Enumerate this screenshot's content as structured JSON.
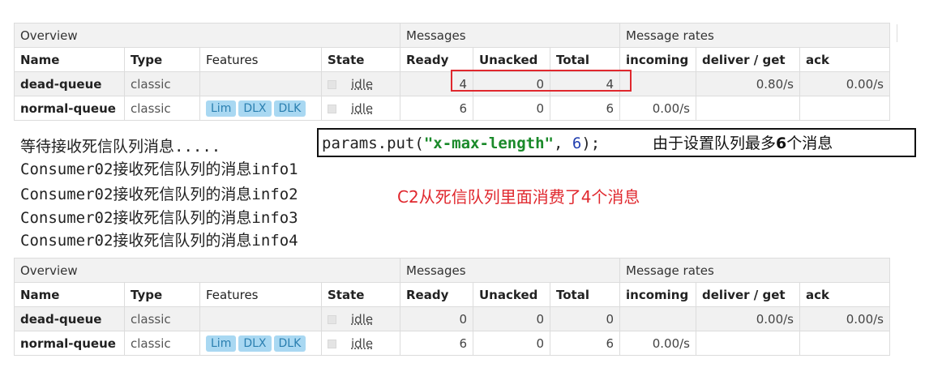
{
  "tables": [
    {
      "groups": {
        "overview": "Overview",
        "messages": "Messages",
        "rates": "Message rates"
      },
      "headers": {
        "name": "Name",
        "type": "Type",
        "features": "Features",
        "state": "State",
        "ready": "Ready",
        "unacked": "Unacked",
        "total": "Total",
        "incoming": "incoming",
        "deliver": "deliver / get",
        "ack": "ack"
      },
      "rows": [
        {
          "name": "dead-queue",
          "type": "classic",
          "state": "idle",
          "ready": "4",
          "unacked": "0",
          "total": "4",
          "incoming": "",
          "deliver": "0.80/s",
          "ack": "0.00/s"
        },
        {
          "name": "normal-queue",
          "type": "classic",
          "features": [
            "Lim",
            "DLX",
            "DLK"
          ],
          "state": "idle",
          "ready": "6",
          "unacked": "0",
          "total": "6",
          "incoming": "0.00/s",
          "deliver": "",
          "ack": ""
        }
      ]
    },
    {
      "groups": {
        "overview": "Overview",
        "messages": "Messages",
        "rates": "Message rates"
      },
      "headers": {
        "name": "Name",
        "type": "Type",
        "features": "Features",
        "state": "State",
        "ready": "Ready",
        "unacked": "Unacked",
        "total": "Total",
        "incoming": "incoming",
        "deliver": "deliver / get",
        "ack": "ack"
      },
      "rows": [
        {
          "name": "dead-queue",
          "type": "classic",
          "state": "idle",
          "ready": "0",
          "unacked": "0",
          "total": "0",
          "incoming": "",
          "deliver": "0.00/s",
          "ack": "0.00/s"
        },
        {
          "name": "normal-queue",
          "type": "classic",
          "features": [
            "Lim",
            "DLX",
            "DLK"
          ],
          "state": "idle",
          "ready": "6",
          "unacked": "0",
          "total": "6",
          "incoming": "0.00/s",
          "deliver": "",
          "ack": ""
        }
      ]
    }
  ],
  "console": {
    "waiting": "等待接收死信队列消息.....",
    "lines": [
      "Consumer02接收死信队列的消息info1",
      "Consumer02接收死信队列的消息info2",
      "Consumer02接收死信队列的消息info3",
      "Consumer02接收死信队列的消息info4"
    ]
  },
  "code_annotation": {
    "prefix": "params.put(",
    "key": "\"x-max-length\"",
    "sep": ", ",
    "value": "6",
    "suffix": ");",
    "note_pre": "由于设置队列最多",
    "note_num": "6",
    "note_post": "个消息"
  },
  "red_note": "C2从死信队列里面消费了4个消息",
  "colors": {
    "highlight_red": "#e0282e",
    "tag_bg": "#a9d8f2",
    "code_string": "#1a8a2a"
  }
}
